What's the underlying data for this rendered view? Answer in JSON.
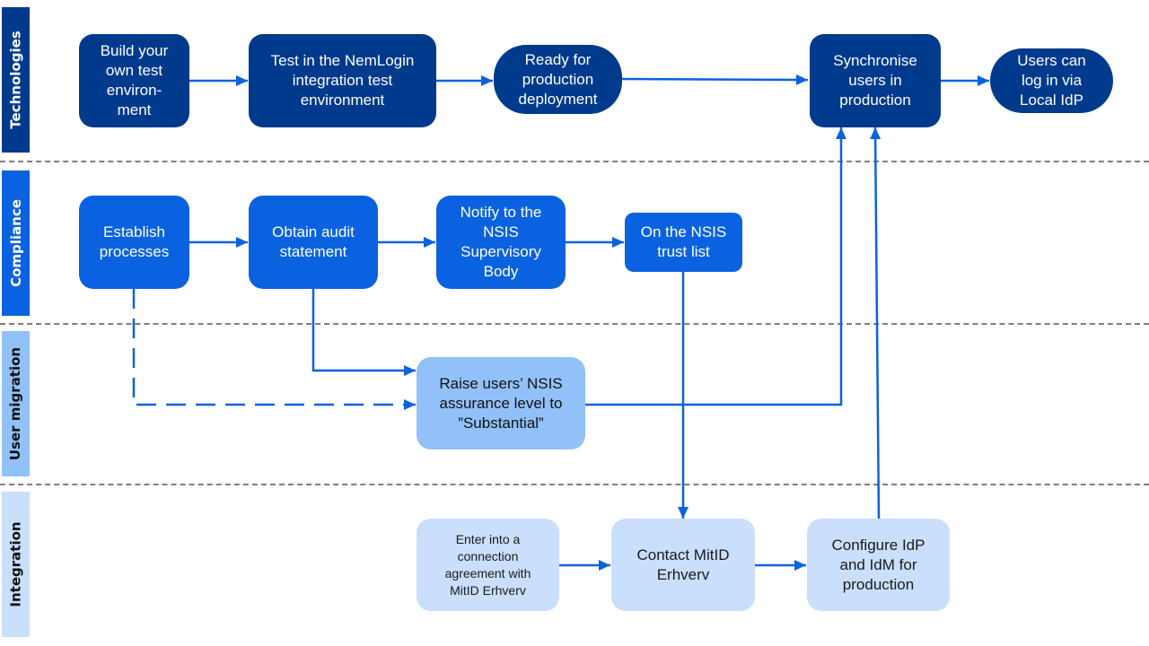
{
  "colors": {
    "technologies": "#003a8c",
    "compliance": "#0a62e0",
    "user_migration": "#91c1f8",
    "integration": "#c9dffc",
    "arrow": "#0a62e0",
    "divider": "#7f7f7f"
  },
  "lanes": [
    {
      "id": "technologies",
      "label": "Technologies"
    },
    {
      "id": "compliance",
      "label": "Compliance"
    },
    {
      "id": "user_migration",
      "label": "User migration"
    },
    {
      "id": "integration",
      "label": "Integration"
    }
  ],
  "nodes": {
    "build_test_env": {
      "lane": "technologies",
      "text": "Build your own test environ- ment"
    },
    "test_nemlogin": {
      "lane": "technologies",
      "text": "Test in the NemLogin integration test environment"
    },
    "ready_production": {
      "lane": "technologies",
      "text": "Ready for production deployment"
    },
    "synchronise_users": {
      "lane": "technologies",
      "text": "Synchronise users in production"
    },
    "users_login": {
      "lane": "technologies",
      "text": "Users can log in via Local IdP"
    },
    "establish_processes": {
      "lane": "compliance",
      "text": "Establish processes"
    },
    "obtain_audit": {
      "lane": "compliance",
      "text": "Obtain audit statement"
    },
    "notify_nsis": {
      "lane": "compliance",
      "text": "Notify to the NSIS Supervisory Body"
    },
    "nsis_trust_list": {
      "lane": "compliance",
      "text": "On the NSIS trust list"
    },
    "raise_assurance": {
      "lane": "user_migration",
      "text": "Raise users’ NSIS assurance level to ”Substantial”"
    },
    "connection_agreement": {
      "lane": "integration",
      "text": "Enter into a connection agreement with MitID Erhverv"
    },
    "contact_mitid": {
      "lane": "integration",
      "text": "Contact MitID Erhverv"
    },
    "configure_idp": {
      "lane": "integration",
      "text": "Configure IdP and IdM for production"
    }
  },
  "edges": [
    {
      "from": "build_test_env",
      "to": "test_nemlogin",
      "style": "solid"
    },
    {
      "from": "test_nemlogin",
      "to": "ready_production",
      "style": "solid"
    },
    {
      "from": "ready_production",
      "to": "synchronise_users",
      "style": "solid"
    },
    {
      "from": "synchronise_users",
      "to": "users_login",
      "style": "solid"
    },
    {
      "from": "establish_processes",
      "to": "obtain_audit",
      "style": "solid"
    },
    {
      "from": "obtain_audit",
      "to": "notify_nsis",
      "style": "solid"
    },
    {
      "from": "notify_nsis",
      "to": "nsis_trust_list",
      "style": "solid"
    },
    {
      "from": "obtain_audit",
      "to": "raise_assurance",
      "style": "solid"
    },
    {
      "from": "establish_processes",
      "to": "raise_assurance",
      "style": "dashed"
    },
    {
      "from": "raise_assurance",
      "to": "synchronise_users",
      "style": "solid"
    },
    {
      "from": "nsis_trust_list",
      "to": "contact_mitid",
      "style": "solid"
    },
    {
      "from": "connection_agreement",
      "to": "contact_mitid",
      "style": "solid"
    },
    {
      "from": "contact_mitid",
      "to": "configure_idp",
      "style": "solid"
    },
    {
      "from": "configure_idp",
      "to": "synchronise_users",
      "style": "solid"
    }
  ]
}
